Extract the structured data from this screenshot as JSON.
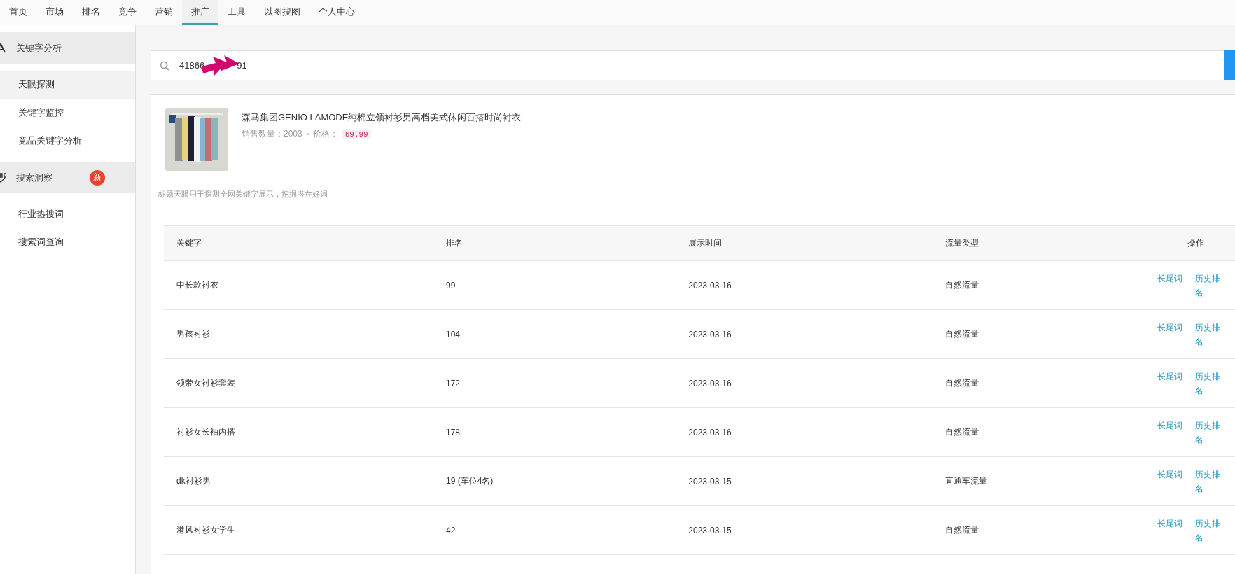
{
  "nav": [
    {
      "label": "首页",
      "selected": false
    },
    {
      "label": "市场",
      "selected": false
    },
    {
      "label": "排名",
      "selected": false
    },
    {
      "label": "竞争",
      "selected": false
    },
    {
      "label": "营销",
      "selected": false
    },
    {
      "label": "推广",
      "selected": true
    },
    {
      "label": "工具",
      "selected": false
    },
    {
      "label": "以图搜图",
      "selected": false
    },
    {
      "label": "个人中心",
      "selected": false
    }
  ],
  "sidebar": [
    {
      "label": "关键字分析",
      "children": [
        {
          "label": "天眼探测",
          "selected": true
        },
        {
          "label": "关键字监控",
          "selected": false
        },
        {
          "label": "竞品关键字分析",
          "selected": false
        }
      ]
    },
    {
      "label": "搜索洞察",
      "badge": "新",
      "children": [
        {
          "label": "行业热搜词",
          "selected": false
        },
        {
          "label": "搜索词查询",
          "selected": false
        }
      ]
    }
  ],
  "search": {
    "value_parts": [
      "41866",
      "91"
    ]
  },
  "product": {
    "title": "森马集团GENIO LAMODE纯棉立领衬衫男高档美式休闲百搭时尚衬衣",
    "sales_label": "销售数量：2003",
    "price_label": "价格：",
    "price": "69.99",
    "hint": "标题天眼用于探测全网关键字展示，挖掘潜在好词"
  },
  "table": {
    "columns": [
      "关键字",
      "排名",
      "展示时间",
      "流量类型",
      "操作"
    ],
    "rows": [
      {
        "cells": [
          "中长款衬衣",
          "99",
          "2023-03-16",
          "自然流量"
        ],
        "actions": [
          "长尾词",
          "历史排名"
        ]
      },
      {
        "cells": [
          "男孩衬衫",
          "104",
          "2023-03-16",
          "自然流量"
        ],
        "actions": [
          "长尾词",
          "历史排名"
        ]
      },
      {
        "cells": [
          "领带女衬衫套装",
          "172",
          "2023-03-16",
          "自然流量"
        ],
        "actions": [
          "长尾词",
          "历史排名"
        ]
      },
      {
        "cells": [
          "衬衫女长袖内搭",
          "178",
          "2023-03-16",
          "自然流量"
        ],
        "actions": [
          "长尾词",
          "历史排名"
        ]
      },
      {
        "cells": [
          "dk衬衫男",
          "19 (车位4名)",
          "2023-03-15",
          "直通车流量"
        ],
        "actions": [
          "长尾词",
          "历史排名"
        ]
      },
      {
        "cells": [
          "港风衬衫女学生",
          "42",
          "2023-03-15",
          "自然流量"
        ],
        "actions": [
          "长尾词",
          "历史排名"
        ]
      }
    ]
  }
}
